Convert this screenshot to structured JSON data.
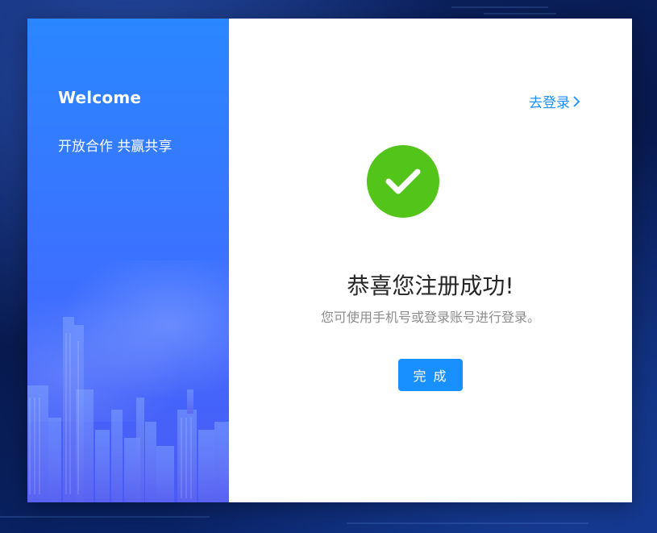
{
  "left_panel": {
    "welcome": "Welcome",
    "slogan": "开放合作 共赢共享"
  },
  "right_panel": {
    "login_link": "去登录",
    "title": "恭喜您注册成功!",
    "subtitle": "您可使用手机号或登录账号进行登录。",
    "done_button": "完 成"
  },
  "colors": {
    "primary": "#1890ff",
    "success": "#52c41a",
    "left_gradient_top": "#2a87ff",
    "left_gradient_bottom": "#4a59f5"
  },
  "icons": {
    "success": "check-circle-icon",
    "login_chevron": "chevron-right-icon"
  }
}
